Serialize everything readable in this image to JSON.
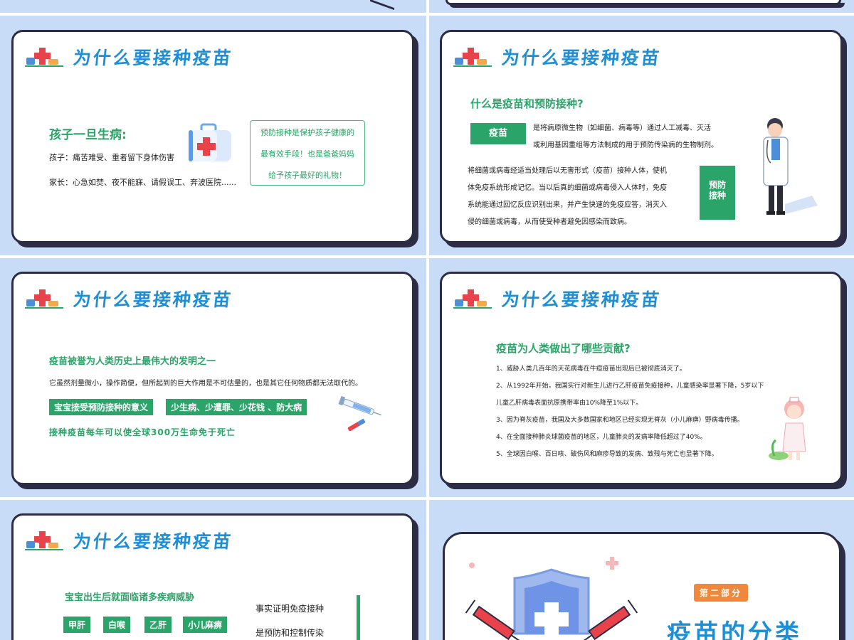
{
  "slide_title": "为什么要接种疫苗",
  "slide1": {
    "heading": "孩子一旦生病:",
    "child_line": "孩子：痛苦难受、重者留下身体伤害",
    "parent_line": "家长：心急如焚、夜不能寐、请假误工、奔波医院......",
    "box_lines": [
      "预防接种是保护孩子健康的",
      "最有效手段！也是爸爸妈妈",
      "给予孩子最好的礼物！"
    ]
  },
  "slide2": {
    "question": "什么是疫苗和预防接种?",
    "vaccine_label": "疫苗",
    "vaccine_def": [
      "是将病原微生物（如细菌、病毒等）通过人工减毒、灭活",
      "或利用基因重组等方法制成的用于预防传染病的生物制剂。"
    ],
    "immunization_text": [
      "将细菌或病毒经适当处理后以无害形式（疫苗）接种人体，使机",
      "体免疫系统形成记忆。当以后真的细菌或病毒侵入人体时，免疫",
      "系统能通过回忆反应识别出来，并产生快速的免疫应答，消灭入",
      "侵的细菌或病毒，从而使受种者避免因感染而致病。"
    ],
    "prevent_label": [
      "预防",
      "接种"
    ]
  },
  "slide3": {
    "heading": "疫苗被誉为人类历史上最伟大的发明之一",
    "subtext": "它虽然剂量微小，操作简便，但所起到的巨大作用是不可估量的，也是其它任何物质都无法取代的。",
    "tag1": "宝宝接受预防接种的意义",
    "tag2": "少生病、少遭罪、少花钱  、防大病",
    "stat": "接种疫苗每年可以使全球300万生命免于死亡"
  },
  "slide4": {
    "question": "疫苗为人类做出了哪些贡献?",
    "items": [
      "1、威胁人类几百年的天花病毒在牛痘疫苗出现后已被彻底消灭了。",
      "2、从1992年开始，我国实行对新生儿进行乙肝疫苗免疫接种，儿童感染率显著下降，5岁以下",
      "儿童乙肝病毒表面抗原携带率由10%降至1%以下。",
      "3、因为脊灰疫苗，我国及大多数国家和地区已经实现无脊灰（小儿麻痹）野病毒传播。",
      "4、在全面接种肺炎球菌疫苗的地区，儿童肺炎的发病率降低超过了40%。",
      "5、全球因白喉、百日咳、破伤风和麻疹导致的发病、致残与死亡也显著下降。"
    ]
  },
  "slide5": {
    "heading": "宝宝出生后就面临诸多疾病威胁",
    "tags": [
      "甲肝",
      "白喉",
      "乙肝",
      "小儿麻痹"
    ],
    "right_lines": [
      "事实证明免疫接种",
      "是预防和控制传染"
    ]
  },
  "slide6": {
    "part_label": "第二部分",
    "title": "疫苗的分类"
  },
  "colors": {
    "background": "#c8dcf8",
    "title_blue": "#1d8fd6",
    "green": "#2aa468",
    "border": "#2c2c44",
    "orange": "#f0873a"
  }
}
